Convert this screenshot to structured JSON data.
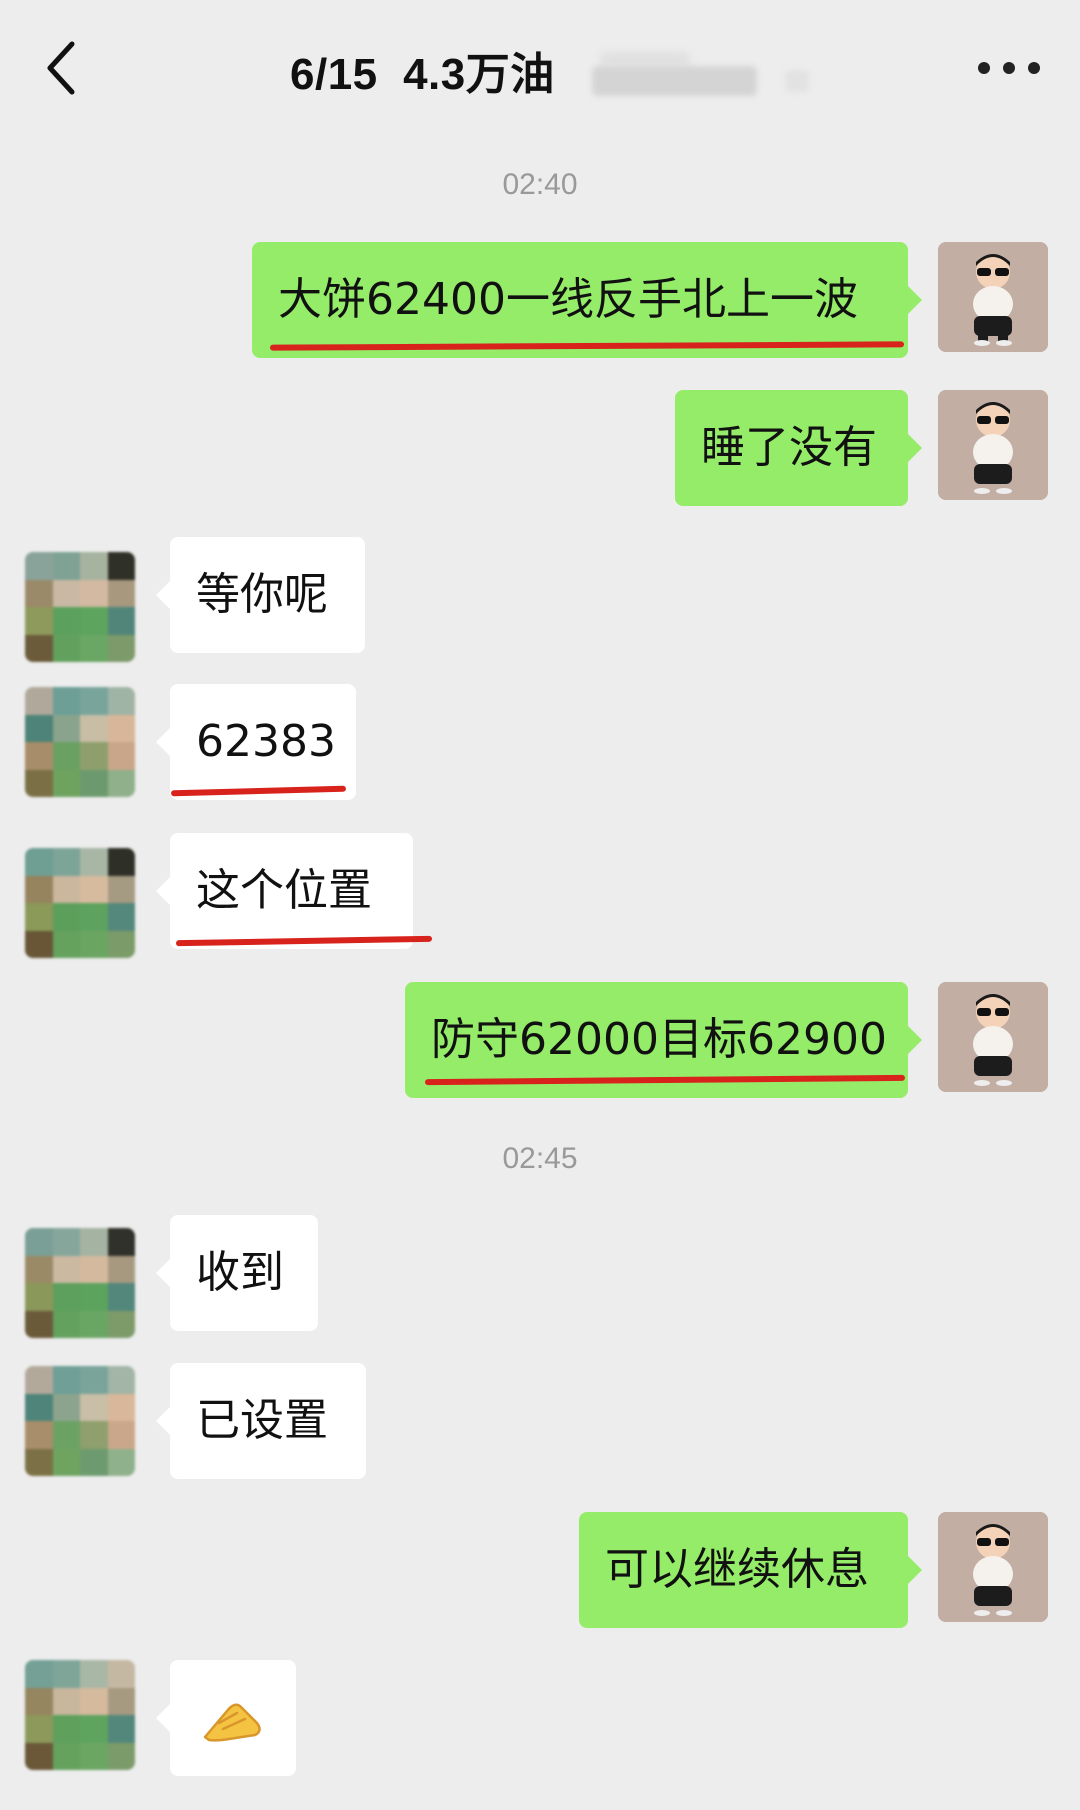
{
  "header": {
    "title": "6/15  4.3万油",
    "back_icon": "chevron-left-icon",
    "more_icon": "more-dots-icon"
  },
  "timestamps": [
    "02:40",
    "02:45"
  ],
  "messages": [
    {
      "sender": "me",
      "text": "大饼62400一线反手北上一波",
      "underlined": true
    },
    {
      "sender": "me",
      "text": "睡了没有",
      "underlined": false
    },
    {
      "sender": "other",
      "text": "等你呢",
      "underlined": false
    },
    {
      "sender": "other",
      "text": "62383",
      "underlined": true
    },
    {
      "sender": "other",
      "text": "这个位置",
      "underlined": true
    },
    {
      "sender": "me",
      "text": "防守62000目标62900",
      "underlined": true
    },
    {
      "sender": "other",
      "text": "收到",
      "underlined": false
    },
    {
      "sender": "other",
      "text": "已设置",
      "underlined": false
    },
    {
      "sender": "me",
      "text": "可以继续休息",
      "underlined": false
    },
    {
      "sender": "other",
      "text": "",
      "emoji": "folded-hands-emoji",
      "underlined": false
    }
  ],
  "colors": {
    "background": "#ededed",
    "my_bubble": "#95ec69",
    "their_bubble": "#ffffff",
    "annotation_underline": "#d8221c"
  }
}
